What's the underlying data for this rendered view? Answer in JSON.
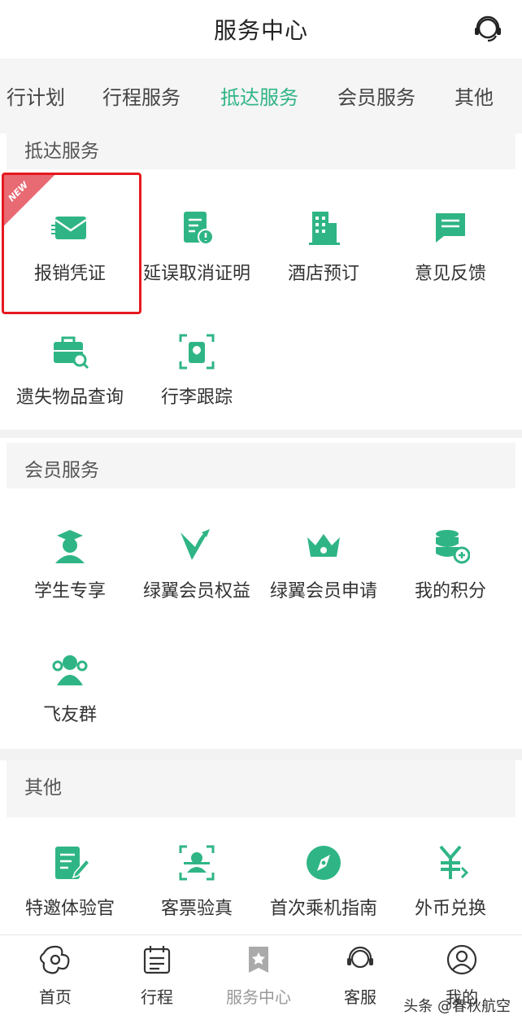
{
  "header": {
    "title": "服务中心",
    "support_icon": "customer-service-headset-icon"
  },
  "tabs": [
    {
      "label": "行计划"
    },
    {
      "label": "行程服务"
    },
    {
      "label": "抵达服务",
      "active": true
    },
    {
      "label": "会员服务"
    },
    {
      "label": "其他"
    }
  ],
  "sections": {
    "arrival": {
      "title": "抵达服务",
      "badge": "NEW",
      "items": [
        {
          "label": "报销凭证",
          "icon": "envelope-icon"
        },
        {
          "label": "延误取消证明",
          "icon": "delay-certificate-icon"
        },
        {
          "label": "酒店预订",
          "icon": "hotel-building-icon"
        },
        {
          "label": "意见反馈",
          "icon": "feedback-message-icon"
        },
        {
          "label": "遗失物品查询",
          "icon": "lost-luggage-search-icon"
        },
        {
          "label": "行李跟踪",
          "icon": "luggage-tracking-icon"
        }
      ]
    },
    "member": {
      "title": "会员服务",
      "items": [
        {
          "label": "学生专享",
          "icon": "student-graduation-icon"
        },
        {
          "label": "绿翼会员权益",
          "icon": "green-wing-v-icon"
        },
        {
          "label": "绿翼会员申请",
          "icon": "crown-icon"
        },
        {
          "label": "我的积分",
          "icon": "points-coins-icon"
        },
        {
          "label": "飞友群",
          "icon": "group-users-icon"
        }
      ]
    },
    "other": {
      "title": "其他",
      "items": [
        {
          "label": "特邀体验官",
          "icon": "edit-document-icon"
        },
        {
          "label": "客票验真",
          "icon": "ticket-verify-scan-icon"
        },
        {
          "label": "首次乘机指南",
          "icon": "compass-icon"
        },
        {
          "label": "外币兑换",
          "icon": "currency-exchange-icon"
        }
      ]
    }
  },
  "tabbar": [
    {
      "label": "首页",
      "icon": "home-logo-icon"
    },
    {
      "label": "行程",
      "icon": "calendar-itinerary-icon"
    },
    {
      "label": "服务中心",
      "icon": "service-center-icon",
      "active": true
    },
    {
      "label": "客服",
      "icon": "customer-service-icon"
    },
    {
      "label": "我的",
      "icon": "user-profile-icon"
    }
  ],
  "watermark": "头条 @春秋航空",
  "colors": {
    "accent": "#2fb585",
    "highlight": "#e5191f",
    "badge": "#e86a73"
  }
}
